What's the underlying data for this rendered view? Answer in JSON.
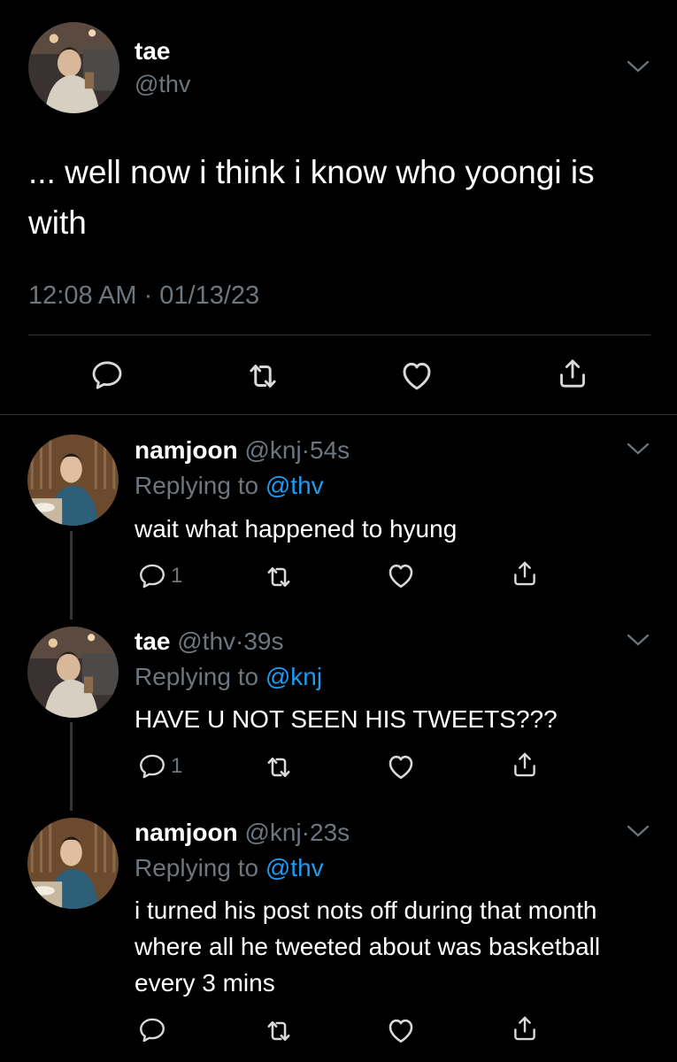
{
  "main_tweet": {
    "name": "tae",
    "handle": "@thv",
    "text": "... well now i think i know who yoongi is with",
    "timestamp": "12:08 AM · 01/13/23",
    "avatar_icon": "avatar-photo"
  },
  "replies": [
    {
      "name": "namjoon",
      "handle": "@knj",
      "separator": "·",
      "age": "54s",
      "replying_prefix": "Replying to",
      "replying_to": "@thv",
      "text": "wait what happened to hyung",
      "reply_count": "1"
    },
    {
      "name": "tae",
      "handle": "@thv",
      "separator": "·",
      "age": "39s",
      "replying_prefix": "Replying to",
      "replying_to": "@knj",
      "text": "HAVE U NOT SEEN HIS TWEETS???",
      "reply_count": "1"
    },
    {
      "name": "namjoon",
      "handle": "@knj",
      "separator": "·",
      "age": "23s",
      "replying_prefix": "Replying to",
      "replying_to": "@thv",
      "text": "i turned his post nots off during that month where all he tweeted about was basketball every 3 mins",
      "reply_count": ""
    }
  ],
  "icons": {
    "reply": "comment-icon",
    "retweet": "retweet-icon",
    "like": "heart-icon",
    "share": "share-icon",
    "more": "chevron-down-icon"
  },
  "colors": {
    "background": "#000000",
    "text": "#ffffff",
    "secondary": "#6e767d",
    "link": "#1d9bf0",
    "divider": "#2f3336"
  }
}
